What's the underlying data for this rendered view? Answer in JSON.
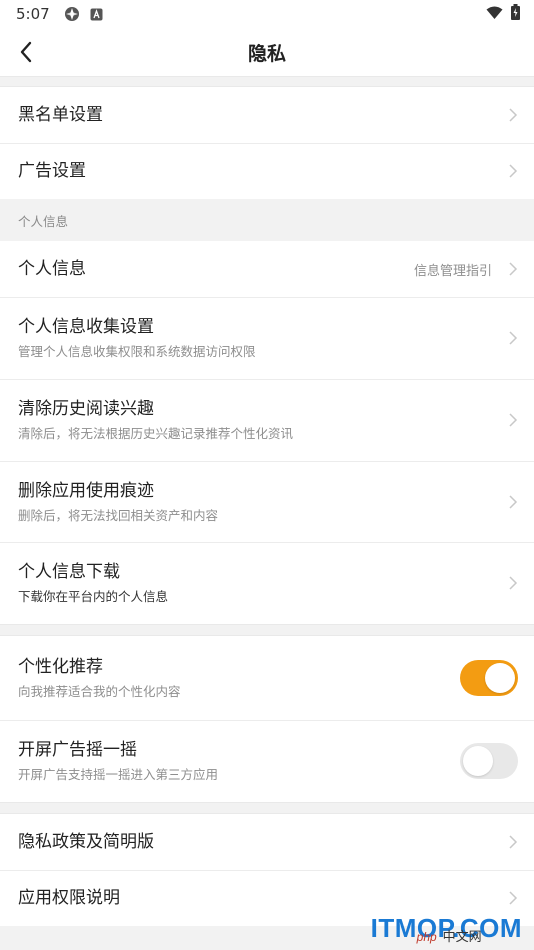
{
  "status_bar": {
    "time": "5:07"
  },
  "nav": {
    "title": "隐私"
  },
  "group1": [
    {
      "title": "黑名单设置"
    },
    {
      "title": "广告设置"
    }
  ],
  "section_personal": {
    "header": "个人信息",
    "items": [
      {
        "title": "个人信息",
        "right_text": "信息管理指引"
      },
      {
        "title": "个人信息收集设置",
        "subtitle": "管理个人信息收集权限和系统数据访问权限"
      },
      {
        "title": "清除历史阅读兴趣",
        "subtitle": "清除后，将无法根据历史兴趣记录推荐个性化资讯"
      },
      {
        "title": "删除应用使用痕迹",
        "subtitle": "删除后，将无法找回相关资产和内容"
      },
      {
        "title": "个人信息下载",
        "subtitle": "下载你在平台内的个人信息"
      }
    ]
  },
  "toggles": [
    {
      "title": "个性化推荐",
      "subtitle": "向我推荐适合我的个性化内容",
      "state": "on"
    },
    {
      "title": "开屏广告摇一摇",
      "subtitle": "开屏广告支持摇一摇进入第三方应用",
      "state": "off"
    }
  ],
  "group_bottom": [
    {
      "title": "隐私政策及简明版"
    },
    {
      "title": "应用权限说明"
    }
  ],
  "watermark": {
    "main": "ITMOP.COM",
    "php": "php",
    "cn": "中文网"
  },
  "colors": {
    "accent": "#f39c12",
    "background": "#f2f2f2",
    "watermark": "#1a7ad4"
  }
}
